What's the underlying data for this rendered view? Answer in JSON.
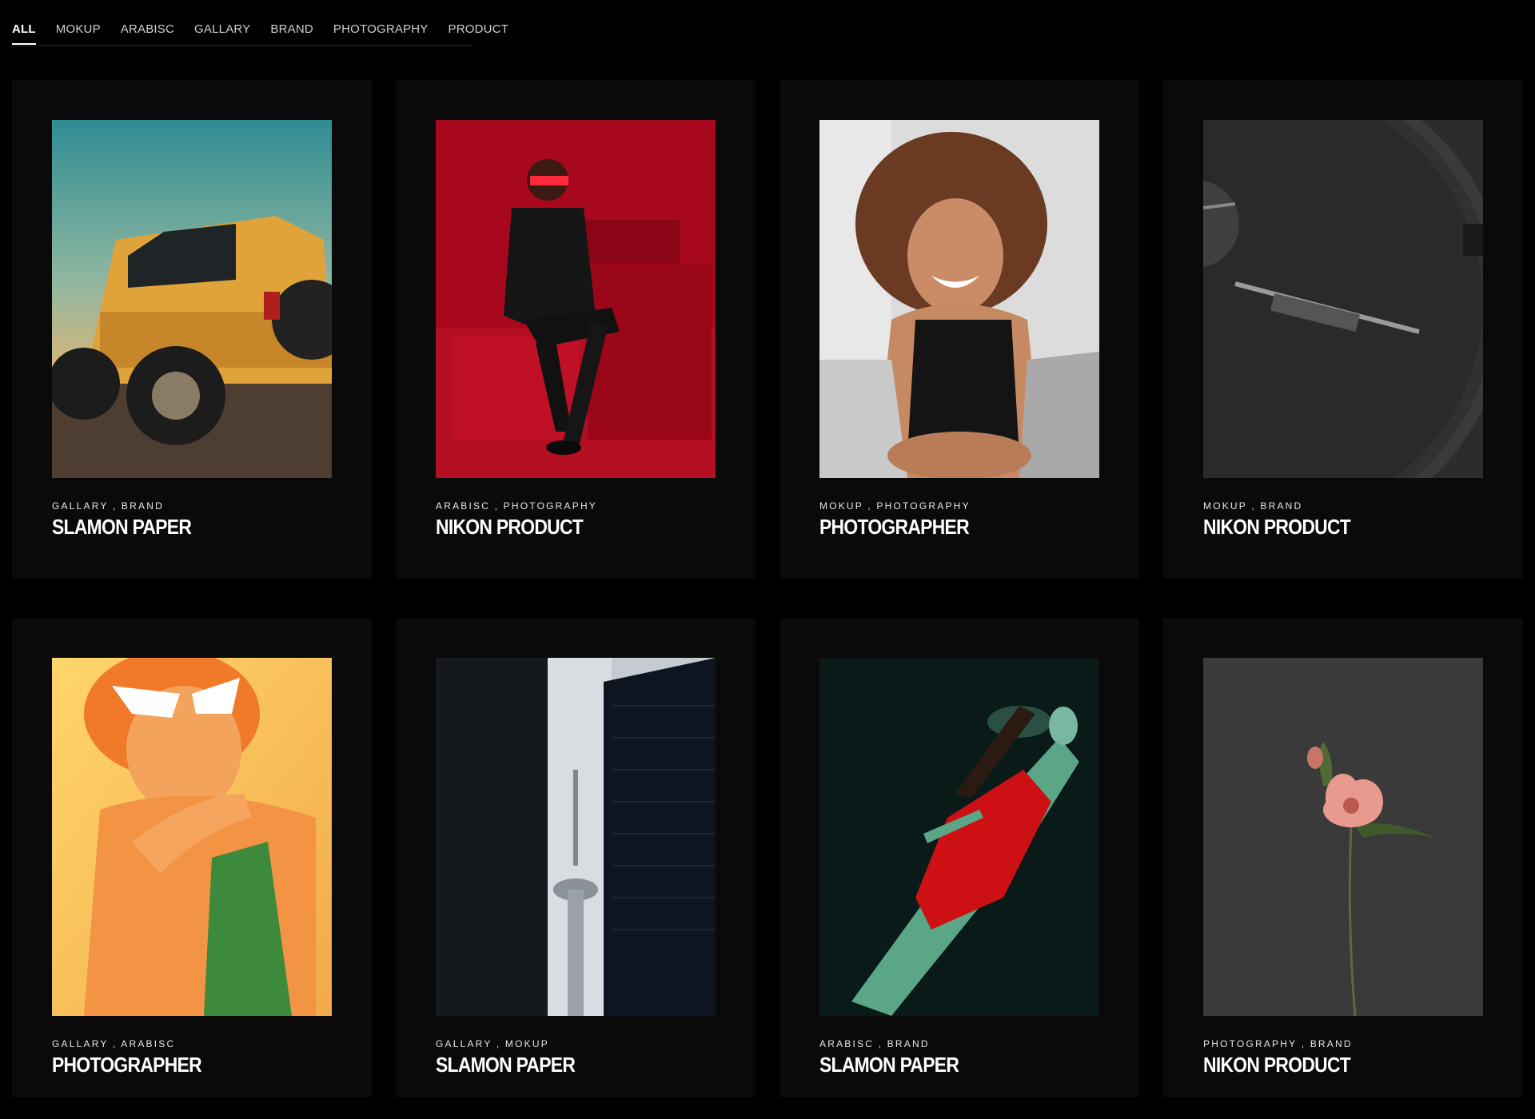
{
  "filters": [
    "ALL",
    "MOKUP",
    "ARABISC",
    "GALLARY",
    "BRAND",
    "PHOTOGRAPHY",
    "PRODUCT"
  ],
  "active_filter": "ALL",
  "cards": [
    {
      "tags": "GALLARY , BRAND",
      "title": "SLAMON PAPER",
      "image": "yellow-jeep-photo"
    },
    {
      "tags": "ARABISC , PHOTOGRAPHY",
      "title": "NIKON PRODUCT",
      "image": "man-red-background-photo"
    },
    {
      "tags": "MOKUP , PHOTOGRAPHY",
      "title": "PHOTOGRAPHER",
      "image": "smiling-woman-curly-hair-photo"
    },
    {
      "tags": "MOKUP , BRAND",
      "title": "NIKON PRODUCT",
      "image": "watch-dial-closeup-photo"
    },
    {
      "tags": "GALLARY , ARABISC",
      "title": "PHOTOGRAPHER",
      "image": "woman-sunglasses-orange-photo"
    },
    {
      "tags": "GALLARY , MOKUP",
      "title": "SLAMON PAPER",
      "image": "tower-between-buildings-photo"
    },
    {
      "tags": "ARABISC , BRAND",
      "title": "SLAMON PAPER",
      "image": "underwater-woman-red-dress-photo"
    },
    {
      "tags": "PHOTOGRAPHY , BRAND",
      "title": "NIKON PRODUCT",
      "image": "pink-flower-dark-photo"
    }
  ],
  "colors": {
    "background": "#000000",
    "card": "#0a0a0a",
    "text": "#ffffff"
  }
}
